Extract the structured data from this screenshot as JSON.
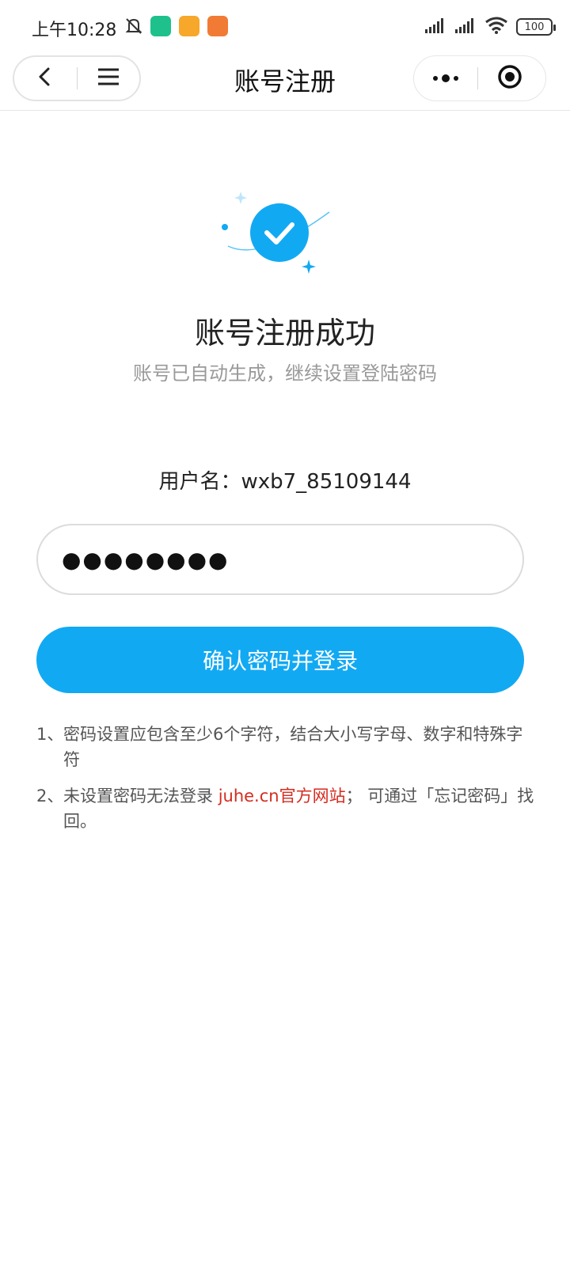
{
  "status_bar": {
    "time": "上午10:28",
    "battery": "100",
    "icons": [
      "bell-off-icon",
      "green-app-icon",
      "orange-app-icon",
      "red-app-icon",
      "signal-icon",
      "signal-icon",
      "wifi-icon",
      "battery-icon"
    ]
  },
  "nav": {
    "title": "账号注册",
    "left_icons": [
      "back-arrow-icon",
      "menu-icon"
    ],
    "right_icons": [
      "more-dots-icon",
      "close-target-icon"
    ]
  },
  "success": {
    "title": "账号注册成功",
    "subtitle": "账号已自动生成，继续设置登陆密码",
    "accent_color": "#12a9f3"
  },
  "account": {
    "username_label": "用户名：",
    "username_value": "wxb7_85109144"
  },
  "password": {
    "value": "●●●●●●●●"
  },
  "confirm_button": {
    "label": "确认密码并登录",
    "color": "#12a9f3"
  },
  "notes": {
    "item1_num": "1、",
    "item1_text": "密码设置应包含至少6个字符，结合大小写字母、数字和特殊字符",
    "item2_num": "2、",
    "item2_prefix": "未设置密码无法登录 ",
    "item2_link": "juhe.cn官方网站",
    "item2_suffix": "； 可通过「忘记密码」找回。"
  }
}
